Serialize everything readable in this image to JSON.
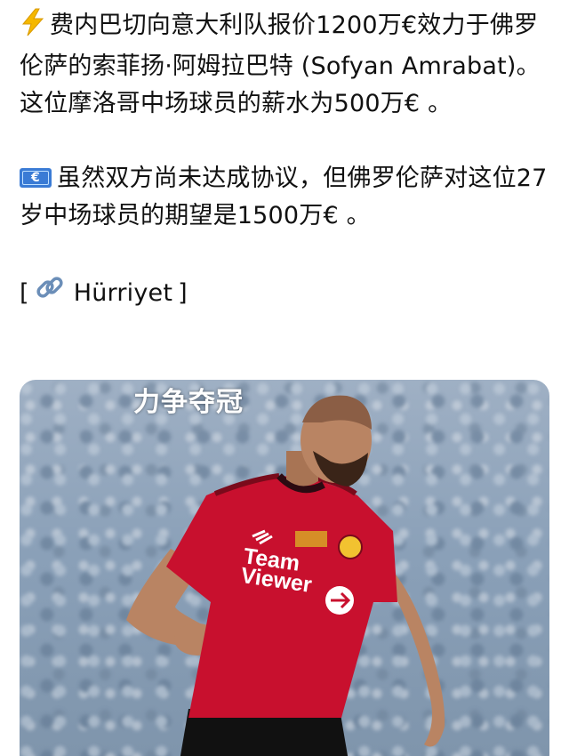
{
  "post": {
    "paragraph1": "费内巴切向意大利队报价1200万€效力于佛罗伦萨的索菲扬·阿姆拉巴特 (Sofyan Amrabat)。这位摩洛哥中场球员的薪水为500万€ 。",
    "paragraph2": "虽然双方尚未达成协议，但佛罗伦萨对这位27岁中场球员的期望是1500万€ 。",
    "source_open": "[",
    "source_name": "Hürriyet",
    "source_close": "]"
  },
  "media": {
    "watermark": "力争夺冠",
    "sponsor_line1": "Team",
    "sponsor_line2": "Viewer"
  },
  "icons": {
    "first_paragraph": "lightning-bolt-icon",
    "second_paragraph": "euro-banknote-icon",
    "source": "link-icon"
  },
  "colors": {
    "jersey": "#c8102e",
    "bolt": "#f5b800",
    "link": "#6b8eb8"
  }
}
